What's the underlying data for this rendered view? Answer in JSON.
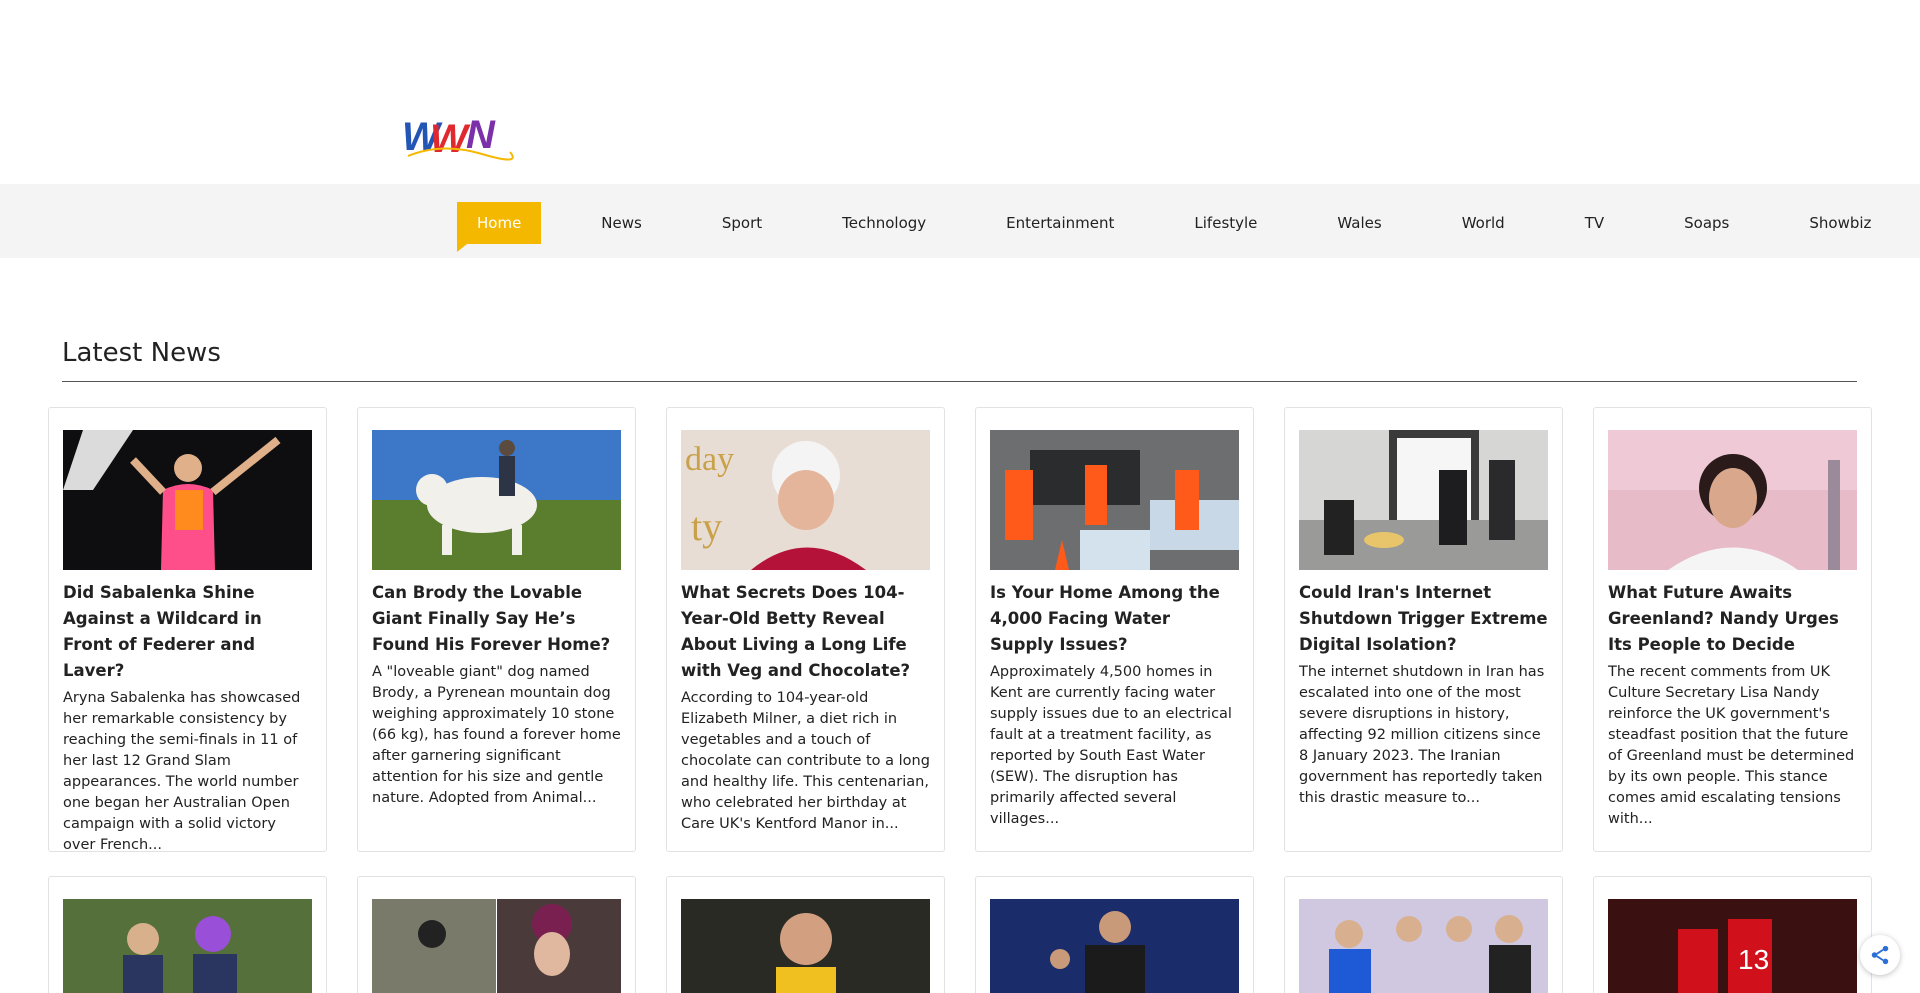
{
  "site": {
    "logo_text": "WWN"
  },
  "nav": {
    "items": [
      {
        "label": "Home",
        "active": true
      },
      {
        "label": "News"
      },
      {
        "label": "Sport"
      },
      {
        "label": "Technology"
      },
      {
        "label": "Entertainment"
      },
      {
        "label": "Lifestyle"
      },
      {
        "label": "Wales"
      },
      {
        "label": "World"
      },
      {
        "label": "TV"
      },
      {
        "label": "Soaps"
      },
      {
        "label": "Showbiz"
      }
    ],
    "active_color": "#f5b800"
  },
  "latest": {
    "heading": "Latest News",
    "articles": [
      {
        "title": "Did Sabalenka Shine Against a Wildcard in Front of Federer and Laver?",
        "excerpt": "Aryna Sabalenka has showcased her remarkable consistency by reaching the semi-finals in 11 of her last 12 Grand Slam appearances. The world number one began her Australian Open campaign with a solid victory over French..."
      },
      {
        "title": "Can Brody the Lovable Giant Finally Say He’s Found His Forever Home?",
        "excerpt": "A \"loveable giant\" dog named Brody, a Pyrenean mountain dog weighing approximately 10 stone (66 kg), has found a forever home after garnering significant attention for his size and gentle nature. Adopted from Animal..."
      },
      {
        "title": "What Secrets Does 104-Year-Old Betty Reveal About Living a Long Life with Veg and Chocolate?",
        "excerpt": "According to 104-year-old Elizabeth Milner, a diet rich in vegetables and a touch of chocolate can contribute to a long and healthy life. This centenarian, who celebrated her birthday at Care UK's Kentford Manor in..."
      },
      {
        "title": "Is Your Home Among the 4,000 Facing Water Supply Issues?",
        "excerpt": "Approximately 4,500 homes in Kent are currently facing water supply issues due to an electrical fault at a treatment facility, as reported by South East Water (SEW). The disruption has primarily affected several villages..."
      },
      {
        "title": "Could Iran's Internet Shutdown Trigger Extreme Digital Isolation?",
        "excerpt": "The internet shutdown in Iran has escalated into one of the most severe disruptions in history, affecting 92 million citizens since 8 January 2023. The Iranian government has reportedly taken this drastic measure to..."
      },
      {
        "title": "What Future Awaits Greenland? Nandy Urges Its People to Decide",
        "excerpt": "The recent comments from UK Culture Secretary Lisa Nandy reinforce the UK government's steadfast position that the future of Greenland must be determined by its own people. This stance comes amid escalating tensions with..."
      }
    ]
  }
}
